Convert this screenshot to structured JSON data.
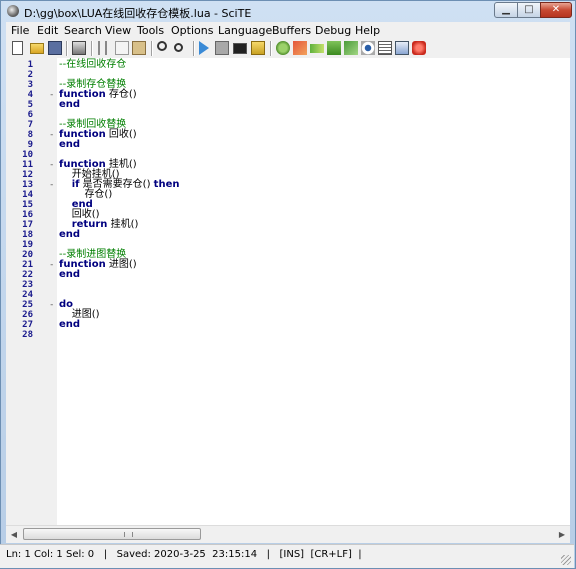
{
  "window": {
    "title": "D:\\gg\\box\\LUA在线回收存仓模板.lua - SciTE"
  },
  "window_controls": {
    "minimize": "▁",
    "maximize": "□",
    "close": "✕"
  },
  "menu": [
    "File",
    "Edit",
    "Search",
    "View",
    "Tools",
    "Options",
    "Language",
    "Buffers",
    "Debug",
    "Help"
  ],
  "toolbar_icons": [
    "new-file-icon",
    "open-folder-icon",
    "save-icon",
    "print-icon",
    "cut-icon",
    "copy-icon",
    "paste-icon",
    "find-icon",
    "replace-icon",
    "compile-icon",
    "stop-icon",
    "console-icon",
    "open-lua-icon",
    "build-icon",
    "tools-icon",
    "go-icon",
    "bookmark-icon",
    "options-icon",
    "eye-icon",
    "list-icon",
    "export-icon",
    "close-red-icon"
  ],
  "editor": {
    "lines": [
      {
        "n": "1",
        "fold": "",
        "indent": "",
        "tokens": [
          {
            "t": "--在线回收存仓",
            "c": "cm"
          }
        ]
      },
      {
        "n": "2",
        "fold": "",
        "indent": "",
        "tokens": []
      },
      {
        "n": "3",
        "fold": "",
        "indent": "",
        "tokens": [
          {
            "t": "--录制存仓替换",
            "c": "cm"
          }
        ]
      },
      {
        "n": "4",
        "fold": "-",
        "indent": "",
        "tokens": [
          {
            "t": "function",
            "c": "kw"
          },
          {
            "t": " 存仓()",
            "c": ""
          }
        ]
      },
      {
        "n": "5",
        "fold": "",
        "indent": "",
        "tokens": [
          {
            "t": "end",
            "c": "kw"
          }
        ]
      },
      {
        "n": "6",
        "fold": "",
        "indent": "",
        "tokens": []
      },
      {
        "n": "7",
        "fold": "",
        "indent": "",
        "tokens": [
          {
            "t": "--录制回收替换",
            "c": "cm"
          }
        ]
      },
      {
        "n": "8",
        "fold": "-",
        "indent": "",
        "tokens": [
          {
            "t": "function",
            "c": "kw"
          },
          {
            "t": " 回收()",
            "c": ""
          }
        ]
      },
      {
        "n": "9",
        "fold": "",
        "indent": "",
        "tokens": [
          {
            "t": "end",
            "c": "kw"
          }
        ]
      },
      {
        "n": "10",
        "fold": "",
        "indent": "",
        "tokens": []
      },
      {
        "n": "11",
        "fold": "-",
        "indent": "",
        "tokens": [
          {
            "t": "function",
            "c": "kw"
          },
          {
            "t": " 挂机()",
            "c": ""
          }
        ]
      },
      {
        "n": "12",
        "fold": "",
        "indent": "    ",
        "tokens": [
          {
            "t": "开始挂机()",
            "c": ""
          }
        ]
      },
      {
        "n": "13",
        "fold": "-",
        "indent": "    ",
        "tokens": [
          {
            "t": "if",
            "c": "kw"
          },
          {
            "t": " 是否需要存仓() ",
            "c": ""
          },
          {
            "t": "then",
            "c": "kw"
          }
        ]
      },
      {
        "n": "14",
        "fold": "",
        "indent": "        ",
        "tokens": [
          {
            "t": "存仓()",
            "c": ""
          }
        ]
      },
      {
        "n": "15",
        "fold": "",
        "indent": "    ",
        "tokens": [
          {
            "t": "end",
            "c": "kw"
          }
        ]
      },
      {
        "n": "16",
        "fold": "",
        "indent": "    ",
        "tokens": [
          {
            "t": "回收()",
            "c": ""
          }
        ]
      },
      {
        "n": "17",
        "fold": "",
        "indent": "    ",
        "tokens": [
          {
            "t": "return",
            "c": "kw"
          },
          {
            "t": " 挂机()",
            "c": ""
          }
        ]
      },
      {
        "n": "18",
        "fold": "",
        "indent": "",
        "tokens": [
          {
            "t": "end",
            "c": "kw"
          }
        ]
      },
      {
        "n": "19",
        "fold": "",
        "indent": "",
        "tokens": []
      },
      {
        "n": "20",
        "fold": "",
        "indent": "",
        "tokens": [
          {
            "t": "--录制进图替换",
            "c": "cm"
          }
        ]
      },
      {
        "n": "21",
        "fold": "-",
        "indent": "",
        "tokens": [
          {
            "t": "function",
            "c": "kw"
          },
          {
            "t": " 进图()",
            "c": ""
          }
        ]
      },
      {
        "n": "22",
        "fold": "",
        "indent": "",
        "tokens": [
          {
            "t": "end",
            "c": "kw"
          }
        ]
      },
      {
        "n": "23",
        "fold": "",
        "indent": "",
        "tokens": []
      },
      {
        "n": "24",
        "fold": "",
        "indent": "",
        "tokens": []
      },
      {
        "n": "25",
        "fold": "-",
        "indent": "",
        "tokens": [
          {
            "t": "do",
            "c": "kw"
          }
        ]
      },
      {
        "n": "26",
        "fold": "",
        "indent": "    ",
        "tokens": [
          {
            "t": "进图()",
            "c": ""
          }
        ]
      },
      {
        "n": "27",
        "fold": "",
        "indent": "",
        "tokens": [
          {
            "t": "end",
            "c": "kw"
          }
        ]
      },
      {
        "n": "28",
        "fold": "",
        "indent": "",
        "tokens": []
      }
    ]
  },
  "scrollbar": {
    "left_arrow": "◀",
    "right_arrow": "▶"
  },
  "status": {
    "text": "Ln: 1 Col: 1 Sel: 0   |   Saved: 2020-3-25  23:15:14   |   [INS]  [CR+LF]  |"
  }
}
